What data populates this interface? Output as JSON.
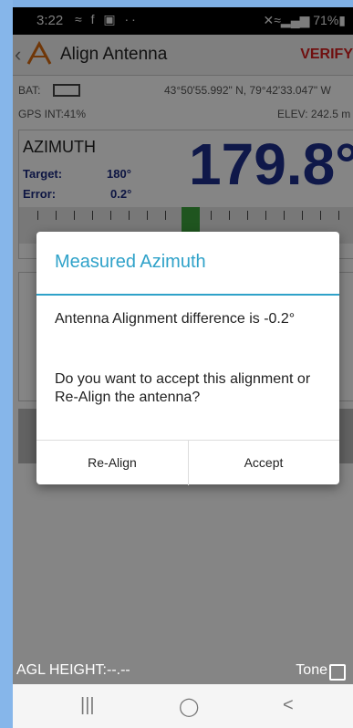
{
  "status": {
    "time": "3:22",
    "left_icons": "≈ f ▣ ··",
    "right_icons": "✕≈▂▄▆ 71%▮"
  },
  "appbar": {
    "back_icon": "chevron-left-icon",
    "title": "Align Antenna",
    "verify": "VERIFY"
  },
  "info": {
    "bat_label": "BAT:",
    "coords": "43°50'55.992\" N,  79°42'33.047\" W",
    "gps_int": "GPS INT:41%",
    "elev": "ELEV: 242.5 m"
  },
  "azimuth": {
    "title": "AZIMUTH",
    "target_label": "Target:",
    "target_value": "180°",
    "error_label": "Error:",
    "error_value": "0.2°",
    "big_value": "179.8°"
  },
  "dialog": {
    "title": "Measured Azimuth",
    "line1": "Antenna Alignment difference is -0.2°",
    "line2": "Do you want to accept this alignment or Re-Align the antenna?",
    "realign": "Re-Align",
    "accept": "Accept"
  },
  "bottom": {
    "agl": "AGL HEIGHT:--.--",
    "tone": "Tone"
  },
  "navbar": {
    "recents_icon": "|||",
    "home_icon": "◯",
    "back_icon": "<"
  }
}
